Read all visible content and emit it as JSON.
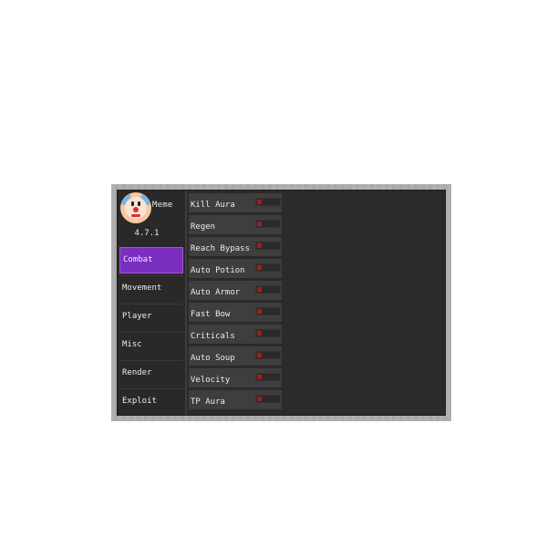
{
  "profile": {
    "name": "Meme",
    "version": "4.7.1"
  },
  "categories": [
    {
      "label": "Combat",
      "active": true
    },
    {
      "label": "Movement",
      "active": false
    },
    {
      "label": "Player",
      "active": false
    },
    {
      "label": "Misc",
      "active": false
    },
    {
      "label": "Render",
      "active": false
    },
    {
      "label": "Exploit",
      "active": false
    }
  ],
  "modules": [
    {
      "label": "Kill Aura",
      "enabled": false
    },
    {
      "label": "Regen",
      "enabled": false
    },
    {
      "label": "Reach Bypass",
      "enabled": false
    },
    {
      "label": "Auto Potion",
      "enabled": false
    },
    {
      "label": "Auto Armor",
      "enabled": false
    },
    {
      "label": "Fast Bow",
      "enabled": false
    },
    {
      "label": "Criticals",
      "enabled": false
    },
    {
      "label": "Auto Soup",
      "enabled": false
    },
    {
      "label": "Velocity",
      "enabled": false
    },
    {
      "label": "TP Aura",
      "enabled": false
    }
  ],
  "colors": {
    "accent": "#7a2fc0",
    "toggle_off": "#b01818",
    "panel": "#2c2a2b",
    "module_bg": "#3f3d3e"
  },
  "icons": {
    "avatar": "clown-face-icon",
    "toggle_knob": "toggle-knob-icon"
  }
}
